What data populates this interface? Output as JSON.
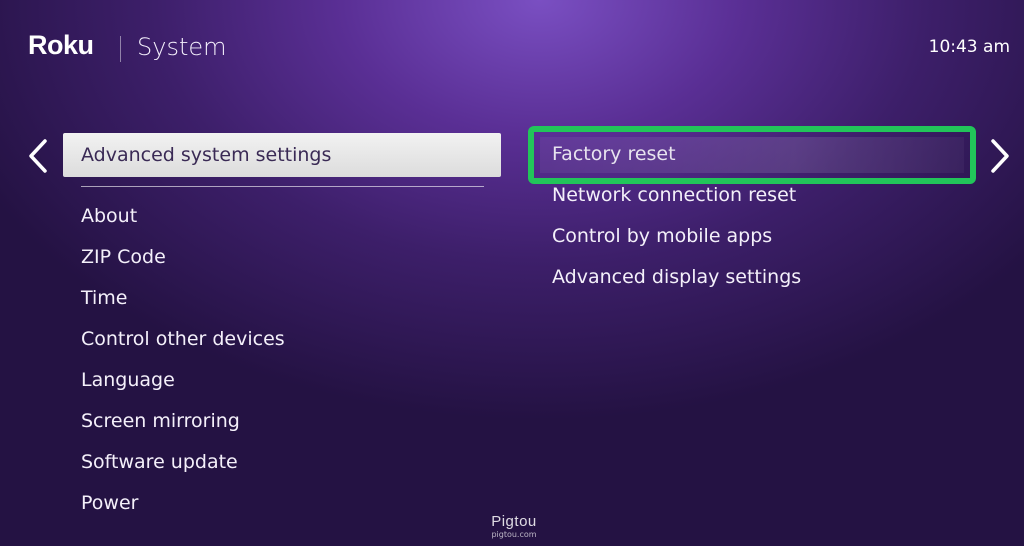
{
  "header": {
    "brand": "Roku",
    "title": "System",
    "time": "10:43 am"
  },
  "left_panel": {
    "selected": "Advanced system settings",
    "items": [
      "About",
      "ZIP Code",
      "Time",
      "Control other devices",
      "Language",
      "Screen mirroring",
      "Software update",
      "Power"
    ]
  },
  "right_panel": {
    "items": [
      "Factory reset",
      "Network connection reset",
      "Control by mobile apps",
      "Advanced display settings"
    ],
    "highlighted_index": 0,
    "highlight_color": "#22c55a"
  },
  "navigation": {
    "back_icon": "chevron-left-icon",
    "forward_icon": "chevron-right-icon"
  },
  "watermark": {
    "name": "Pigtou",
    "url": "pigtou.com"
  },
  "colors": {
    "background": "#3d1f6a",
    "glow": "#7a4fc2",
    "selected_bg": "#e8e8e8",
    "selected_text": "#3a2a55"
  }
}
